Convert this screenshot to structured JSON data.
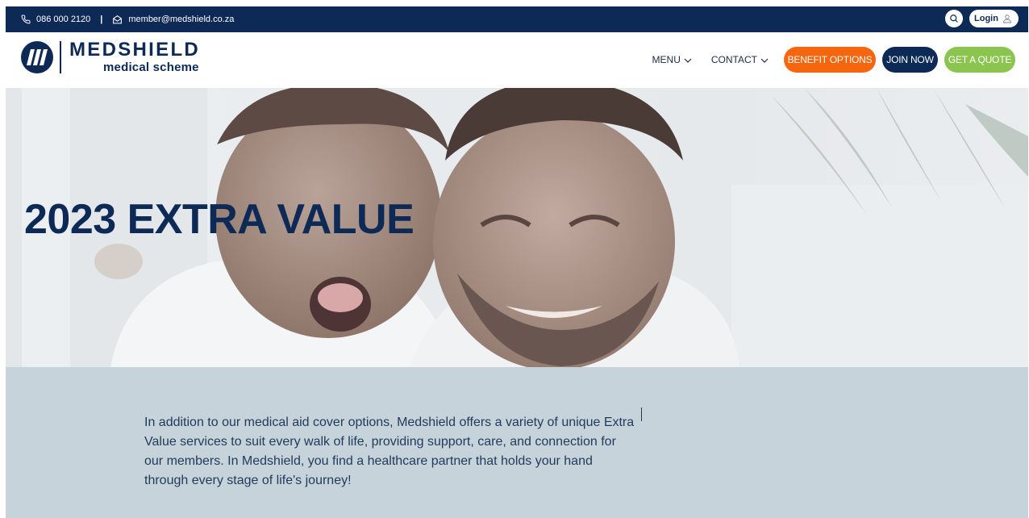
{
  "topbar": {
    "phone": "086 000 2120",
    "separator": "|",
    "email": "member@medshield.co.za",
    "login_label": "Login",
    "icons": [
      "phone-icon",
      "email-icon",
      "search-icon",
      "user-icon"
    ]
  },
  "logo": {
    "name": "MEDSHIELD",
    "subtitle": "medical scheme"
  },
  "nav": {
    "menu_label": "MENU",
    "contact_label": "CONTACT",
    "benefit_label": "BENEFIT OPTIONS",
    "join_label": "JOIN NOW",
    "quote_label": "GET A QUOTE"
  },
  "hero": {
    "title": "2023 EXTRA VALUE"
  },
  "intro": {
    "text": "In addition to our medical aid cover options, Medshield offers a variety of unique Extra Value services to suit every walk of life, providing support, care, and connection for our members. In Medshield, you find a healthcare partner that holds your hand through every stage of life's journey!"
  },
  "colors": {
    "navy": "#0d2a57",
    "orange": "#f5660f",
    "green": "#8cc450",
    "intro_bg": "#c7d3da"
  }
}
